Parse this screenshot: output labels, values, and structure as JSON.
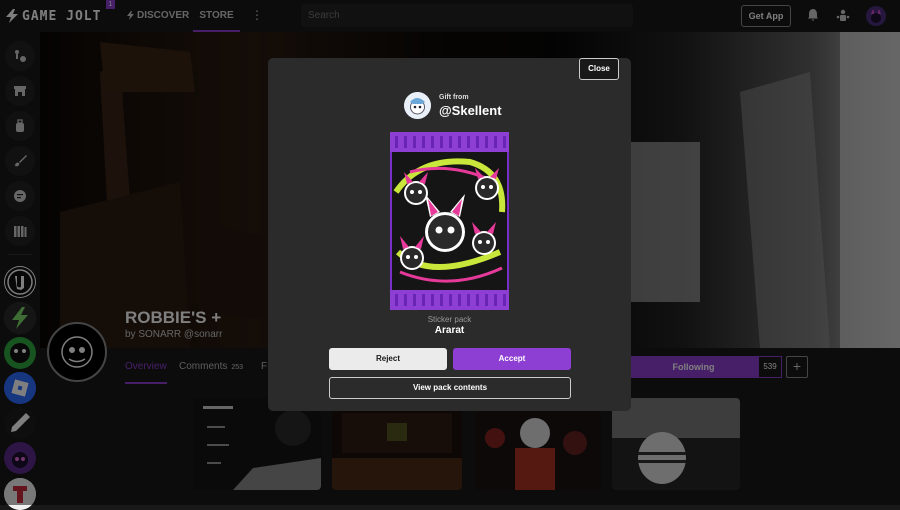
{
  "topbar": {
    "logo_text": "GAME JOLT",
    "logo_badge": "1",
    "discover_label": "DISCOVER",
    "store_label": "STORE",
    "search_placeholder": "Search",
    "get_app_label": "Get App"
  },
  "game": {
    "title": "ROBBIE'S +",
    "by_label": "by",
    "author": "SONARR",
    "handle": "@sonarr",
    "tabs": {
      "overview": "Overview",
      "comments": "Comments",
      "comments_count": "253",
      "partial": "F"
    },
    "following_label": "Following",
    "followers": "539",
    "plus_label": "+"
  },
  "modal": {
    "close_label": "Close",
    "gift_from_label": "Gift from",
    "gift_user": "@Skellent",
    "pack_type": "Sticker pack",
    "pack_name": "Ararat",
    "reject_label": "Reject",
    "accept_label": "Accept",
    "view_label": "View pack contents"
  },
  "colors": {
    "accent": "#8e3fd3",
    "background": "#191919",
    "modal": "#2b2b2b"
  }
}
